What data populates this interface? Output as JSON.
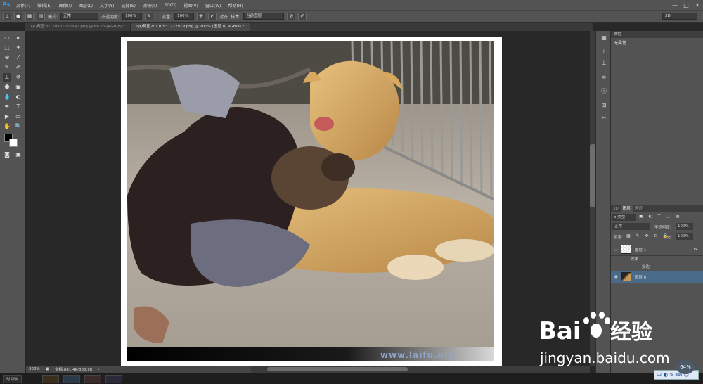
{
  "app": {
    "logo": "Ps"
  },
  "menu": [
    "文件(F)",
    "编辑(E)",
    "图像(I)",
    "图层(L)",
    "文字(Y)",
    "选择(S)",
    "滤镜(T)",
    "3D(D)",
    "视图(V)",
    "窗口(W)",
    "帮助(H)"
  ],
  "window_controls": [
    "—",
    "□",
    "✕"
  ],
  "options": {
    "mode_label": "模式:",
    "mode_value": "正常",
    "opacity_label": "不透明度:",
    "opacity_value": "100%",
    "flow_label": "流量:",
    "flow_value": "100%",
    "align_label": "对齐",
    "sample_label": "样本:",
    "sample_value": "当前图层",
    "workspace": "3D"
  },
  "tabs": [
    {
      "label": "QQ截图20170531222640.png @ 66.7%(RGB/8) *"
    },
    {
      "label": "QQ截图20170531222919.png @ 200% (图层 0, RGB/8) *"
    }
  ],
  "tools": [
    "▭",
    "⬚",
    "⊕",
    "✎",
    "✐",
    "⬟",
    "▣",
    "◐",
    "✒",
    "T",
    "▶",
    "✋",
    "🔍"
  ],
  "canvas": {
    "watermark": "www.laifu.org"
  },
  "status": {
    "zoom": "200%",
    "doc": "文档:691.4K/888.9K",
    "taskbar_label": "时间轴"
  },
  "properties": {
    "title": "属性",
    "empty_text": "无属性"
  },
  "layers_panel": {
    "tabs": [
      "3D",
      "图层",
      "通道"
    ],
    "kind_label": "ρ 类型",
    "blend": "正常",
    "opacity_label": "不透明度:",
    "opacity_value": "100%",
    "lock_label": "锁定:",
    "fill_label": "填充:",
    "fill_value": "100%",
    "layers": [
      {
        "name": "图层 1",
        "fx": "fx"
      },
      {
        "name": "效果"
      },
      {
        "name": "描边"
      },
      {
        "name": "图层 0"
      }
    ]
  },
  "branding": {
    "baidu_text": "Bai",
    "baidu_paw": "经验",
    "baidu_url": "jingyan.baidu.com",
    "ime": "中",
    "ime_percent": "64%"
  },
  "colors": {
    "accent": "#31a8ff",
    "panel": "#535353",
    "canvas": "#282828",
    "selected_layer": "#4a6a8a"
  }
}
